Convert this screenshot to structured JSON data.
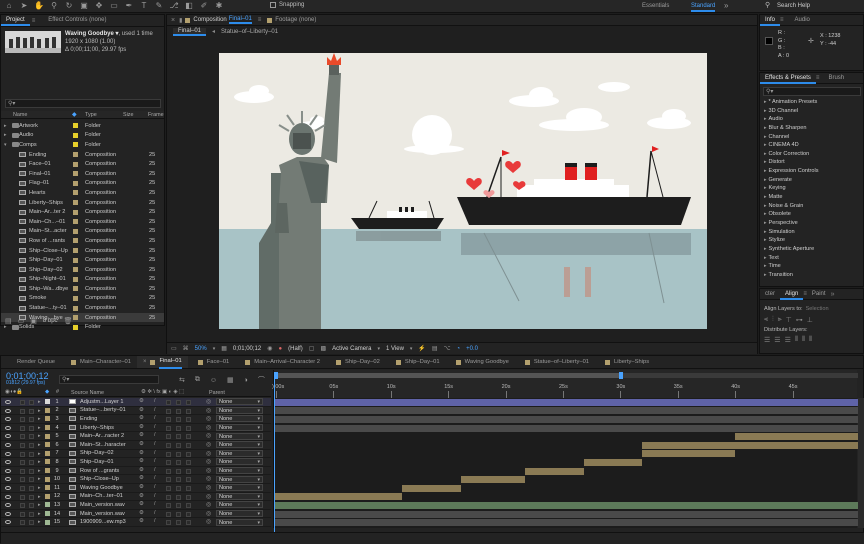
{
  "toolbar": {
    "snapping_label": "Snapping",
    "workspaces": [
      "Essentials",
      "Standard"
    ],
    "active_workspace": "Standard",
    "search_placeholder": "Search Help"
  },
  "project_panel": {
    "tabs": [
      "Project",
      "Effect Controls (none)"
    ],
    "active_tab": "Project",
    "selected_item_name": "Waving Goodbye ▾",
    "used_text": ", used 1 time",
    "resolution": "1920 x 1080 (1.00)",
    "duration": "Δ 0;00;11;00, 29.97 fps",
    "search_placeholder": "",
    "columns": [
      "Name",
      "Type",
      "Size",
      "Frame"
    ],
    "items": [
      {
        "name": "Artwork",
        "type": "Folder",
        "frame": "",
        "kind": "folder",
        "color": "#e6cf2a"
      },
      {
        "name": "Audio",
        "type": "Folder",
        "frame": "",
        "kind": "folder",
        "color": "#e6cf2a"
      },
      {
        "name": "Comps",
        "type": "Folder",
        "frame": "",
        "kind": "folder",
        "color": "#e6cf2a"
      },
      {
        "name": "Ending",
        "type": "Composition",
        "frame": "25",
        "kind": "comp",
        "color": "#b3a06e"
      },
      {
        "name": "Face–01",
        "type": "Composition",
        "frame": "25",
        "kind": "comp",
        "color": "#b3a06e"
      },
      {
        "name": "Final–01",
        "type": "Composition",
        "frame": "25",
        "kind": "comp",
        "color": "#b3a06e"
      },
      {
        "name": "Flag–01",
        "type": "Composition",
        "frame": "25",
        "kind": "comp",
        "color": "#b3a06e"
      },
      {
        "name": "Hearts",
        "type": "Composition",
        "frame": "25",
        "kind": "comp",
        "color": "#b3a06e"
      },
      {
        "name": "Liberty–Ships",
        "type": "Composition",
        "frame": "25",
        "kind": "comp",
        "color": "#b3a06e"
      },
      {
        "name": "Main–Ar...ter 2",
        "type": "Composition",
        "frame": "25",
        "kind": "comp",
        "color": "#b3a06e"
      },
      {
        "name": "Main–Ch...–01",
        "type": "Composition",
        "frame": "25",
        "kind": "comp",
        "color": "#b3a06e"
      },
      {
        "name": "Main–St...acter",
        "type": "Composition",
        "frame": "25",
        "kind": "comp",
        "color": "#b3a06e"
      },
      {
        "name": "Row of ...rants",
        "type": "Composition",
        "frame": "25",
        "kind": "comp",
        "color": "#b3a06e"
      },
      {
        "name": "Ship–Close–Up",
        "type": "Composition",
        "frame": "25",
        "kind": "comp",
        "color": "#b3a06e"
      },
      {
        "name": "Ship–Day–01",
        "type": "Composition",
        "frame": "25",
        "kind": "comp",
        "color": "#b3a06e"
      },
      {
        "name": "Ship–Day–02",
        "type": "Composition",
        "frame": "25",
        "kind": "comp",
        "color": "#b3a06e"
      },
      {
        "name": "Ship–Night–01",
        "type": "Composition",
        "frame": "25",
        "kind": "comp",
        "color": "#b3a06e"
      },
      {
        "name": "Ship–Wa...dbye",
        "type": "Composition",
        "frame": "25",
        "kind": "comp",
        "color": "#b3a06e"
      },
      {
        "name": "Smoke",
        "type": "Composition",
        "frame": "25",
        "kind": "comp",
        "color": "#b3a06e"
      },
      {
        "name": "Statue–...ty–01",
        "type": "Composition",
        "frame": "25",
        "kind": "comp",
        "color": "#b3a06e"
      },
      {
        "name": "Waving ...bye",
        "type": "Composition",
        "frame": "25",
        "kind": "comp",
        "color": "#b3a06e",
        "selected": true
      },
      {
        "name": "Solids",
        "type": "Folder",
        "frame": "",
        "kind": "folder",
        "color": "#e6cf2a"
      }
    ],
    "bpc": "8 bpc"
  },
  "composition_panel": {
    "tab_label": "Composition",
    "tab_name": "Final–01",
    "footage_tab": "Footage (none)",
    "breadcrumbs": [
      "Final–01",
      "Statue–of–Liberty–01"
    ],
    "zoom": "50%",
    "timecode": "0;01;00;12",
    "resolution": "(Half)",
    "camera": "Active Camera",
    "views": "1 View",
    "exposure": "+0.0"
  },
  "info_panel": {
    "tabs": [
      "Info",
      "Audio"
    ],
    "r": "R :",
    "g": "G :",
    "b": "B :",
    "a": "A : 0",
    "x": "X : 1238",
    "y": "Y : -44"
  },
  "effects_panel": {
    "tabs": [
      "Effects & Presets",
      "Brush"
    ],
    "search_placeholder": "",
    "items": [
      "* Animation Presets",
      "3D Channel",
      "Audio",
      "Blur & Sharpen",
      "Channel",
      "CINEMA 4D",
      "Color Correction",
      "Distort",
      "Expression Controls",
      "Generate",
      "Keying",
      "Matte",
      "Noise & Grain",
      "Obsolete",
      "Perspective",
      "Simulation",
      "Stylize",
      "Synthetic Aperture",
      "Text",
      "Time",
      "Transition"
    ]
  },
  "align_panel": {
    "tabs": [
      "cter",
      "Align",
      "Paint"
    ],
    "align_layers_label": "Align Layers to:",
    "align_target": "Selection",
    "distribute_label": "Distribute Layers:"
  },
  "timeline": {
    "tabs": [
      {
        "label": "Render Queue",
        "color": ""
      },
      {
        "label": "Main–Character–01",
        "color": "#b3a06e"
      },
      {
        "label": "Final–01",
        "color": "#b3a06e",
        "active": true
      },
      {
        "label": "Face–01",
        "color": "#b3a06e"
      },
      {
        "label": "Main–Arrival–Character 2",
        "color": "#b3a06e"
      },
      {
        "label": "Ship–Day–02",
        "color": "#b3a06e"
      },
      {
        "label": "Ship–Day–01",
        "color": "#b3a06e"
      },
      {
        "label": "Waving Goodbye",
        "color": "#b3a06e"
      },
      {
        "label": "Statue–of–Liberty–01",
        "color": "#b3a06e"
      },
      {
        "label": "Liberty–Ships",
        "color": "#b3a06e"
      }
    ],
    "current_time": "0;01;00;12",
    "frame_info": "01812 (29.97 fps)",
    "columns": {
      "source": "Source Name",
      "parent": "Parent"
    },
    "ruler": [
      "):00s",
      "05s",
      "10s",
      "15s",
      "20s",
      "25s",
      "30s",
      "35s",
      "40s",
      "45s"
    ],
    "ruler_seconds": [
      0,
      5,
      10,
      15,
      20,
      25,
      30,
      35,
      40,
      45
    ],
    "playhead_seconds": 0,
    "visible_seconds": 50,
    "layers": [
      {
        "num": "1",
        "name": "Adjustm...Layer 1",
        "parent": "None",
        "color": "#d8d8d8",
        "kind": "adj",
        "bar_start": 0,
        "bar_end": 50,
        "bar_color": "#5f63a8"
      },
      {
        "num": "2",
        "name": "Statue–...berty–01",
        "parent": "None",
        "color": "#b3a06e",
        "kind": "comp",
        "bar_start": 0,
        "bar_end": 50,
        "bar_color": "#4a4a4a"
      },
      {
        "num": "3",
        "name": "Ending",
        "parent": "None",
        "color": "#b3a06e",
        "kind": "comp",
        "bar_start": 0,
        "bar_end": 50,
        "bar_color": "#4a4a4a"
      },
      {
        "num": "4",
        "name": "Liberty–Ships",
        "parent": "None",
        "color": "#b3a06e",
        "kind": "comp",
        "bar_start": 0,
        "bar_end": 50,
        "bar_color": "#4a4a4a"
      },
      {
        "num": "5",
        "name": "Main–Ar...racter 2",
        "parent": "None",
        "color": "#b3a06e",
        "kind": "comp",
        "bar_start": 39.5,
        "bar_end": 50,
        "bar_color": "#8a7a54"
      },
      {
        "num": "6",
        "name": "Main–St...haracter",
        "parent": "None",
        "color": "#b3a06e",
        "kind": "comp",
        "bar_start": 31.5,
        "bar_end": 50,
        "bar_color": "#8a7a54"
      },
      {
        "num": "7",
        "name": "Ship–Day–02",
        "parent": "None",
        "color": "#b3a06e",
        "kind": "comp",
        "bar_start": 31.5,
        "bar_end": 39.5,
        "bar_color": "#8a7a54"
      },
      {
        "num": "8",
        "name": "Ship–Day–01",
        "parent": "None",
        "color": "#b3a06e",
        "kind": "comp",
        "bar_start": 26.5,
        "bar_end": 31.5,
        "bar_color": "#8a7a54"
      },
      {
        "num": "9",
        "name": "Row of ...grants",
        "parent": "None",
        "color": "#b3a06e",
        "kind": "comp",
        "bar_start": 21.5,
        "bar_end": 26.5,
        "bar_color": "#8a7a54"
      },
      {
        "num": "10",
        "name": "Ship–Close–Up",
        "parent": "None",
        "color": "#b3a06e",
        "kind": "comp",
        "bar_start": 16,
        "bar_end": 21.5,
        "bar_color": "#8a7a54"
      },
      {
        "num": "11",
        "name": "Waving Goodbye",
        "parent": "None",
        "color": "#b3a06e",
        "kind": "comp",
        "bar_start": 11,
        "bar_end": 16,
        "bar_color": "#8a7a54"
      },
      {
        "num": "12",
        "name": "Main–Ch...ter–01",
        "parent": "None",
        "color": "#b3a06e",
        "kind": "comp",
        "bar_start": 0,
        "bar_end": 11,
        "bar_color": "#8a7a54"
      },
      {
        "num": "13",
        "name": "Main_version.wav",
        "parent": "None",
        "color": "#9fb894",
        "kind": "audio",
        "bar_start": 0,
        "bar_end": 50,
        "bar_color": "#5d7a5a"
      },
      {
        "num": "14",
        "name": "Main_version.wav",
        "parent": "None",
        "color": "#9fb894",
        "kind": "audio",
        "bar_start": 0,
        "bar_end": 50,
        "bar_color": "#4a4a4a"
      },
      {
        "num": "15",
        "name": "1900909...ew.mp3",
        "parent": "None",
        "color": "#9fb894",
        "kind": "audio",
        "bar_start": 0,
        "bar_end": 50,
        "bar_color": "#4a4a4a"
      }
    ]
  }
}
